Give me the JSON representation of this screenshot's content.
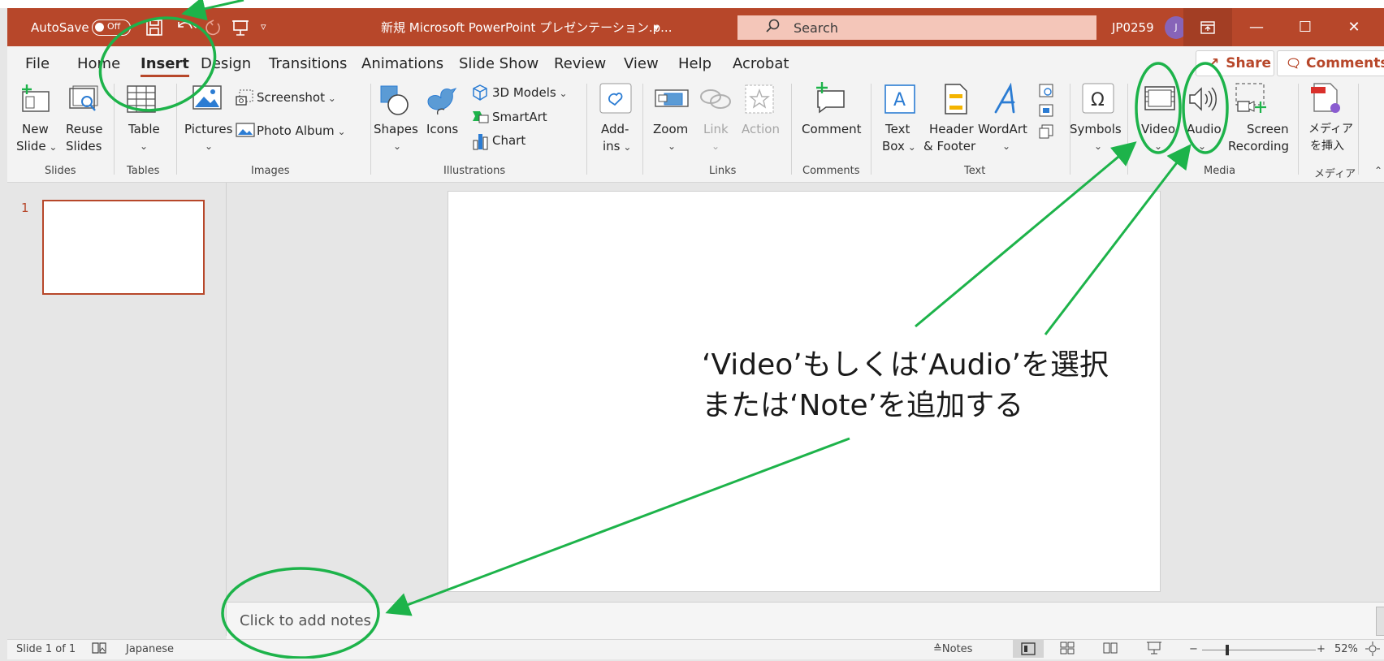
{
  "titlebar": {
    "autosave_label": "AutoSave",
    "autosave_state": "Off",
    "doc_title": "新規 Microsoft PowerPoint プレゼンテーション.p...",
    "search_placeholder": "Search",
    "user_id": "JP0259",
    "user_initial": "J",
    "colors": {
      "bar": "#b7472a",
      "search": "#f4c6b9",
      "avatar": "#8764b8"
    }
  },
  "tabs": [
    "File",
    "Home",
    "Insert",
    "Design",
    "Transitions",
    "Animations",
    "Slide Show",
    "Review",
    "View",
    "Help",
    "Acrobat"
  ],
  "active_tab": "Insert",
  "share_label": "Share",
  "comments_label": "Comments",
  "ribbon": {
    "slides": {
      "new_slide_1": "New",
      "new_slide_2": "Slide",
      "reuse_1": "Reuse",
      "reuse_2": "Slides",
      "group": "Slides"
    },
    "tables": {
      "table": "Table",
      "group": "Tables"
    },
    "images": {
      "pictures": "Pictures",
      "screenshot": "Screenshot",
      "photo_album": "Photo Album",
      "group": "Images"
    },
    "illustrations": {
      "shapes": "Shapes",
      "icons": "Icons",
      "models_3d": "3D Models",
      "smartart": "SmartArt",
      "chart": "Chart",
      "group": "Illustrations"
    },
    "addins": {
      "label_1": "Add-",
      "label_2": "ins"
    },
    "links": {
      "zoom": "Zoom",
      "link": "Link",
      "action": "Action",
      "group": "Links"
    },
    "comments": {
      "comment": "Comment",
      "group": "Comments"
    },
    "text": {
      "textbox_1": "Text",
      "textbox_2": "Box",
      "header_1": "Header",
      "header_2": "& Footer",
      "wordart": "WordArt",
      "group": "Text"
    },
    "symbols": {
      "label": "Symbols"
    },
    "media": {
      "video": "Video",
      "audio": "Audio",
      "screen_1": "Screen",
      "screen_2": "Recording",
      "group": "Media"
    },
    "media_ja": {
      "label_1": "メディア",
      "label_2": "を挿入",
      "group": "メディア"
    }
  },
  "thumbnail_number": "1",
  "annotation": {
    "line1": "‘Video’もしくは‘Audio’を選択",
    "line2": "または‘Note’を追加する"
  },
  "notes_placeholder": "Click to add notes",
  "statusbar": {
    "slide_info": "Slide 1 of 1",
    "language": "Japanese",
    "notes": "Notes",
    "zoom": "52%"
  },
  "annotation_color": "#1db34a"
}
